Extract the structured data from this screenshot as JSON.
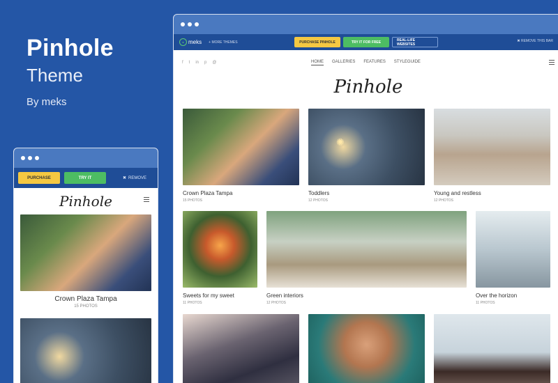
{
  "brand": {
    "title": "Pinhole",
    "subtitle": "Theme",
    "byline": "By meks"
  },
  "mobile": {
    "purchase_label": "PURCHASE",
    "try_label": "TRY IT",
    "remove_label": "REMOVE",
    "logo": "Pinhole",
    "items": [
      {
        "title": "Crown Plaza Tampa",
        "count": "15 PHOTOS"
      }
    ]
  },
  "desktop": {
    "meks_label": "meks",
    "more_themes": "MORE THEMES",
    "purchase_label": "PURCHASE PINHOLE",
    "try_label": "TRY IT FOR FREE",
    "real_life_label": "REAL-LIFE WEBSITES",
    "remove_label": "REMOVE THIS BAR",
    "nav": [
      "HOME",
      "GALLERIES",
      "FEATURES",
      "STYLEGUIDE"
    ],
    "logo": "Pinhole",
    "social": [
      "f",
      "t",
      "in",
      "p",
      "@"
    ],
    "galleries": [
      {
        "title": "Crown Plaza Tampa",
        "count": "15 PHOTOS"
      },
      {
        "title": "Toddlers",
        "count": "12 PHOTOS"
      },
      {
        "title": "Young and restless",
        "count": "12 PHOTOS"
      },
      {
        "title": "Sweets for my sweet",
        "count": "11 PHOTOS"
      },
      {
        "title": "Green interiors",
        "count": "12 PHOTOS"
      },
      {
        "title": "Over the horizon",
        "count": "11 PHOTOS"
      }
    ]
  },
  "colors": {
    "background": "#2456a6",
    "bar": "#1f4d97",
    "chrome": "#4a79c0",
    "yellow": "#f5c842",
    "green": "#4dbd63"
  }
}
